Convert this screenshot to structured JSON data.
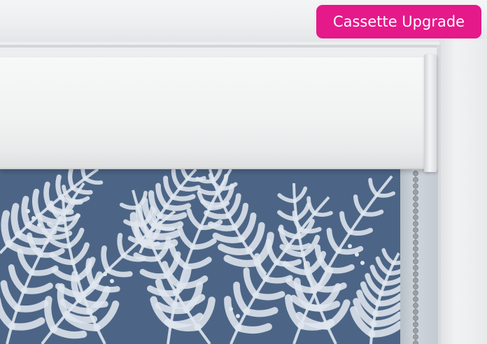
{
  "badge": {
    "label": "Cassette Upgrade"
  },
  "colors": {
    "badge_background": "#e5198a",
    "badge_text": "#ffffff",
    "fabric_background": "#4c6586",
    "fabric_pattern": "#dfe6ee",
    "cassette": "#f1f2f2",
    "frame": "#eceeef",
    "chain": "#9aa0a6"
  }
}
